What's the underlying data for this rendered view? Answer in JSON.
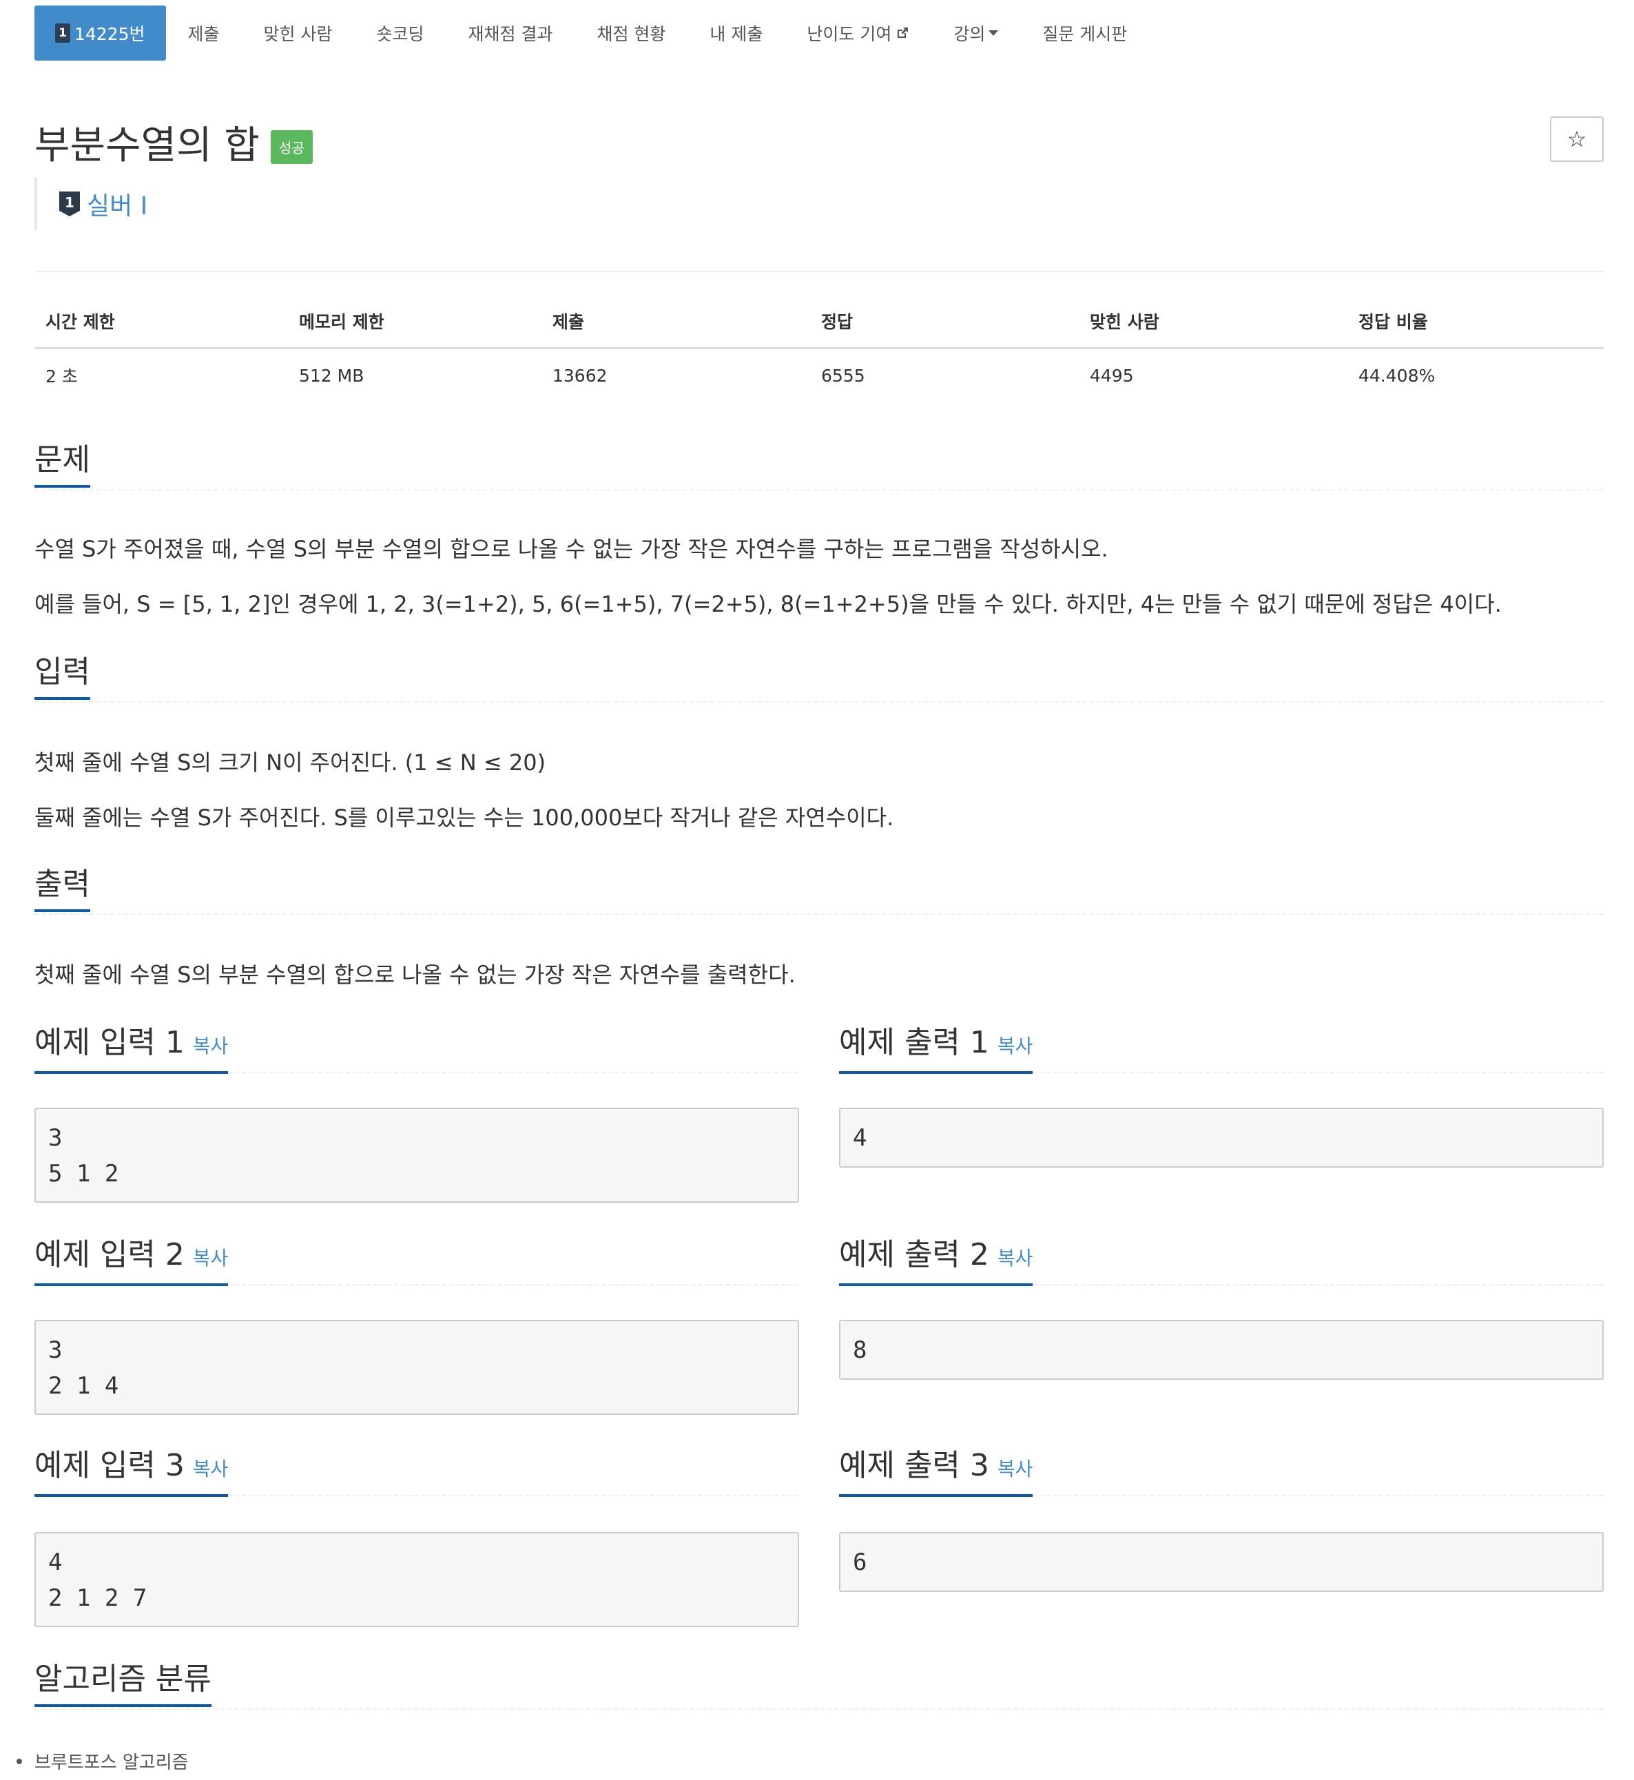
{
  "nav": {
    "problem_number": "14225번",
    "items": [
      "제출",
      "맞힌 사람",
      "숏코딩",
      "재채점 결과",
      "채점 현황",
      "내 제출",
      "난이도 기여",
      "강의",
      "질문 게시판"
    ]
  },
  "tier_digit": "1",
  "problem": {
    "title": "부분수열의 합",
    "status_badge": "성공",
    "star": "☆",
    "tier_label": "실버 I"
  },
  "info_table": {
    "headers": [
      "시간 제한",
      "메모리 제한",
      "제출",
      "정답",
      "맞힌 사람",
      "정답 비율"
    ],
    "values": [
      "2 초",
      "512 MB",
      "13662",
      "6555",
      "4495",
      "44.408%"
    ]
  },
  "sections": {
    "problem_heading": "문제",
    "problem_p1": "수열 S가 주어졌을 때, 수열 S의 부분 수열의 합으로 나올 수 없는 가장 작은 자연수를 구하는 프로그램을 작성하시오.",
    "problem_p2": "예를 들어, S = [5, 1, 2]인 경우에 1, 2, 3(=1+2), 5, 6(=1+5), 7(=2+5), 8(=1+2+5)을 만들 수 있다. 하지만, 4는 만들 수 없기 때문에 정답은 4이다.",
    "input_heading": "입력",
    "input_p1": "첫째 줄에 수열 S의 크기 N이 주어진다. (1 ≤ N ≤ 20)",
    "input_p2": "둘째 줄에는 수열 S가 주어진다. S를 이루고있는 수는 100,000보다 작거나 같은 자연수이다.",
    "output_heading": "출력",
    "output_p1": "첫째 줄에 수열 S의 부분 수열의 합으로 나올 수 없는 가장 작은 자연수를 출력한다."
  },
  "copy_label": "복사",
  "examples": [
    {
      "input_title": "예제 입력 1",
      "input": "3\n5 1 2",
      "output_title": "예제 출력 1",
      "output": "4"
    },
    {
      "input_title": "예제 입력 2",
      "input": "3\n2 1 4",
      "output_title": "예제 출력 2",
      "output": "8"
    },
    {
      "input_title": "예제 입력 3",
      "input": "4\n2 1 2 7",
      "output_title": "예제 출력 3",
      "output": "6"
    }
  ],
  "algorithm": {
    "heading": "알고리즘 분류",
    "items": [
      "브루트포스 알고리즘"
    ]
  }
}
